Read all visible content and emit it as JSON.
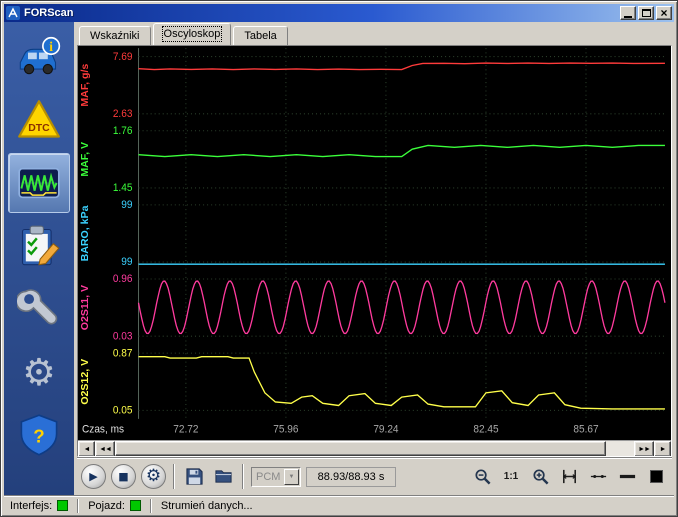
{
  "window": {
    "title": "FORScan"
  },
  "icons": {
    "close": "×",
    "play": "▶",
    "stop": "■",
    "gear": "⚙",
    "settings_gear": "⚙",
    "dropdown_arrow": "▼",
    "info": "i",
    "help": "?"
  },
  "sidebar": {
    "dtc_label": "DTC",
    "items": [
      {
        "name": "vehicle-info",
        "active": false
      },
      {
        "name": "dtc",
        "active": false
      },
      {
        "name": "oscilloscope",
        "active": true
      },
      {
        "name": "tests",
        "active": false
      },
      {
        "name": "service",
        "active": false
      },
      {
        "name": "settings",
        "active": false
      },
      {
        "name": "help",
        "active": false
      }
    ]
  },
  "tabs": [
    {
      "label": "Wskaźniki",
      "active": false
    },
    {
      "label": "Oscyloskop",
      "active": true
    },
    {
      "label": "Tabela",
      "active": false
    }
  ],
  "scope": {
    "x_axis": {
      "label": "Czas, ms",
      "ticks": [
        {
          "frac": 0.09,
          "label": "72.72"
        },
        {
          "frac": 0.28,
          "label": "75.96"
        },
        {
          "frac": 0.47,
          "label": "79.24"
        },
        {
          "frac": 0.66,
          "label": "82.45"
        },
        {
          "frac": 0.85,
          "label": "85.67"
        }
      ]
    },
    "channels": [
      {
        "name": "MAF, g/s",
        "color": "#ff3b3b",
        "max": 7.69,
        "min": 2.63,
        "max_label": "7.69",
        "min_label": "2.63"
      },
      {
        "name": "MAF, V",
        "color": "#3bff3b",
        "max": 1.76,
        "min": 1.45,
        "max_label": "1.76",
        "min_label": "1.45"
      },
      {
        "name": "BARO, kPa",
        "color": "#3bd2ff",
        "max": 99,
        "min": 99,
        "max_label": "99",
        "min_label": "99"
      },
      {
        "name": "O2S11, V",
        "color": "#ff3b9e",
        "max": 0.96,
        "min": 0.03,
        "max_label": "0.96",
        "min_label": "0.03"
      },
      {
        "name": "O2S12, V",
        "color": "#ffff4a",
        "max": 0.87,
        "min": 0.05,
        "max_label": "0.87",
        "min_label": "0.05"
      }
    ]
  },
  "chart_data": {
    "type": "line",
    "title": "FORScan oscilloscope - 5 PID traces vs time",
    "xlabel": "Czas, ms",
    "x_ticks": [
      "72.72",
      "75.96",
      "79.24",
      "82.45",
      "85.67"
    ],
    "legend_position": "left-rotated",
    "grid": true,
    "series": [
      {
        "name": "MAF, g/s",
        "color": "#ff3b3b",
        "ylim": [
          2.63,
          7.69
        ],
        "points": [
          [
            0,
            6.62
          ],
          [
            0.03,
            6.55
          ],
          [
            0.06,
            6.6
          ],
          [
            0.1,
            6.56
          ],
          [
            0.14,
            6.6
          ],
          [
            0.18,
            6.55
          ],
          [
            0.22,
            6.6
          ],
          [
            0.26,
            6.56
          ],
          [
            0.3,
            6.6
          ],
          [
            0.34,
            6.55
          ],
          [
            0.38,
            6.58
          ],
          [
            0.42,
            6.55
          ],
          [
            0.46,
            6.57
          ],
          [
            0.5,
            6.55
          ],
          [
            0.52,
            6.9
          ],
          [
            0.54,
            7.08
          ],
          [
            0.58,
            7.1
          ],
          [
            0.62,
            7.06
          ],
          [
            0.66,
            7.12
          ],
          [
            0.7,
            7.08
          ],
          [
            0.74,
            7.12
          ],
          [
            0.78,
            7.08
          ],
          [
            0.82,
            7.12
          ],
          [
            0.86,
            7.09
          ],
          [
            0.9,
            7.12
          ],
          [
            0.94,
            7.08
          ],
          [
            1,
            7.1
          ]
        ]
      },
      {
        "name": "MAF, V",
        "color": "#3bff3b",
        "ylim": [
          1.45,
          1.76
        ],
        "points": [
          [
            0,
            1.63
          ],
          [
            0.05,
            1.62
          ],
          [
            0.1,
            1.63
          ],
          [
            0.15,
            1.62
          ],
          [
            0.2,
            1.63
          ],
          [
            0.25,
            1.62
          ],
          [
            0.3,
            1.63
          ],
          [
            0.35,
            1.62
          ],
          [
            0.4,
            1.63
          ],
          [
            0.45,
            1.62
          ],
          [
            0.5,
            1.62
          ],
          [
            0.52,
            1.66
          ],
          [
            0.55,
            1.68
          ],
          [
            0.6,
            1.67
          ],
          [
            0.65,
            1.68
          ],
          [
            0.7,
            1.67
          ],
          [
            0.75,
            1.68
          ],
          [
            0.8,
            1.67
          ],
          [
            0.85,
            1.68
          ],
          [
            0.9,
            1.67
          ],
          [
            0.95,
            1.68
          ],
          [
            1,
            1.68
          ]
        ]
      },
      {
        "name": "BARO, kPa",
        "color": "#3bd2ff",
        "ylim": [
          99,
          99
        ],
        "points": [
          [
            0,
            99
          ],
          [
            1,
            99
          ]
        ]
      },
      {
        "name": "O2S11, V",
        "color": "#ff3b9e",
        "ylim": [
          0.03,
          0.96
        ],
        "wave": {
          "type": "sine",
          "cycles": 16,
          "mid": 0.5,
          "amp": 0.43,
          "phase_deg": 170
        }
      },
      {
        "name": "O2S12, V",
        "color": "#ffff4a",
        "ylim": [
          0.05,
          0.87
        ],
        "points": [
          [
            0,
            0.82
          ],
          [
            0.05,
            0.82
          ],
          [
            0.06,
            0.8
          ],
          [
            0.11,
            0.8
          ],
          [
            0.12,
            0.82
          ],
          [
            0.17,
            0.82
          ],
          [
            0.18,
            0.8
          ],
          [
            0.21,
            0.8
          ],
          [
            0.22,
            0.6
          ],
          [
            0.24,
            0.3
          ],
          [
            0.26,
            0.17
          ],
          [
            0.29,
            0.15
          ],
          [
            0.31,
            0.24
          ],
          [
            0.33,
            0.26
          ],
          [
            0.35,
            0.15
          ],
          [
            0.38,
            0.12
          ],
          [
            0.4,
            0.26
          ],
          [
            0.43,
            0.29
          ],
          [
            0.45,
            0.15
          ],
          [
            0.48,
            0.12
          ],
          [
            0.5,
            0.24
          ],
          [
            0.53,
            0.27
          ],
          [
            0.55,
            0.14
          ],
          [
            0.58,
            0.1
          ],
          [
            0.64,
            0.1
          ],
          [
            0.66,
            0.3
          ],
          [
            0.69,
            0.33
          ],
          [
            0.71,
            0.16
          ],
          [
            0.74,
            0.12
          ],
          [
            0.76,
            0.27
          ],
          [
            0.79,
            0.3
          ],
          [
            0.81,
            0.13
          ],
          [
            0.84,
            0.08
          ],
          [
            0.9,
            0.07
          ],
          [
            1,
            0.07
          ]
        ]
      }
    ]
  },
  "scrollbar": {
    "buttons": [
      "◄",
      "◄◄",
      "►►",
      "►"
    ]
  },
  "toolbar": {
    "module_select": {
      "value": "PCM",
      "disabled": true
    },
    "time_display": "88.93/88.93 s",
    "zoom_reset_label": "1:1"
  },
  "statusbar": {
    "interface_label": "Interfejs:",
    "interface_status_color": "#00c800",
    "vehicle_label": "Pojazd:",
    "vehicle_status_color": "#00c800",
    "message": "Strumień danych..."
  }
}
